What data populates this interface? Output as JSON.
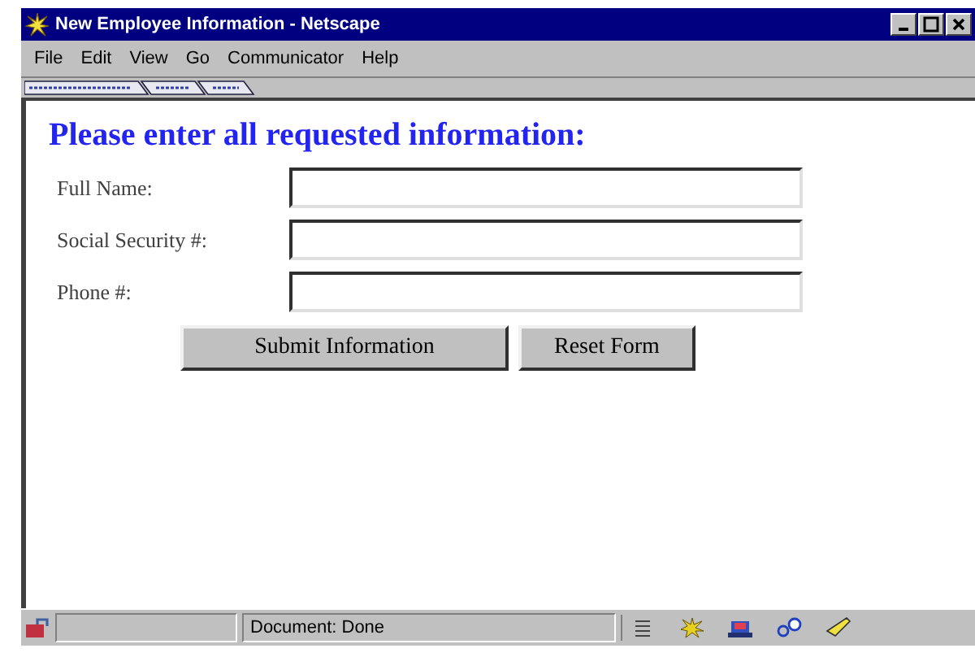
{
  "window": {
    "title": "New Employee Information - Netscape"
  },
  "menu": [
    "File",
    "Edit",
    "View",
    "Go",
    "Communicator",
    "Help"
  ],
  "heading": "Please enter all requested information:",
  "fields": [
    {
      "label": "Full Name:"
    },
    {
      "label": "Social Security #:"
    },
    {
      "label": "Phone #:"
    }
  ],
  "buttons": [
    "Submit Information",
    "Reset Form"
  ],
  "status_bar": {
    "text": "Document: Done"
  }
}
